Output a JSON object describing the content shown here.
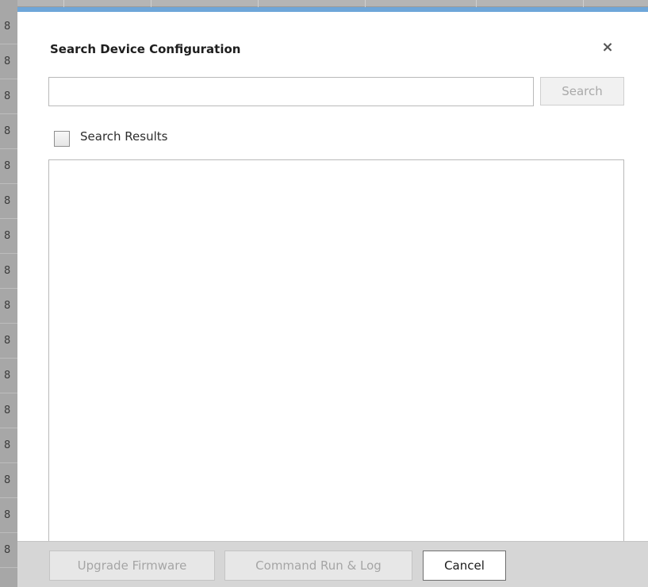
{
  "dialog": {
    "title": "Search Device Configuration",
    "close_glyph": "×",
    "close_icon": "close-icon",
    "search": {
      "value": "",
      "placeholder": "",
      "button_label": "Search"
    },
    "results": {
      "checkbox_checked": false,
      "label": "Search Results"
    },
    "footer": {
      "buttons": [
        {
          "label": "Upgrade Firmware",
          "enabled": false
        },
        {
          "label": "Command Run & Log",
          "enabled": false
        },
        {
          "label": "Cancel",
          "enabled": true
        }
      ]
    },
    "accent_color": "#6ea6d9"
  },
  "background": {
    "row_labels": [
      "8",
      "8",
      "8",
      "8",
      "8",
      "8",
      "8",
      "8",
      "8",
      "8",
      "8",
      "8",
      "8",
      "8",
      "8",
      "8",
      "8"
    ]
  }
}
